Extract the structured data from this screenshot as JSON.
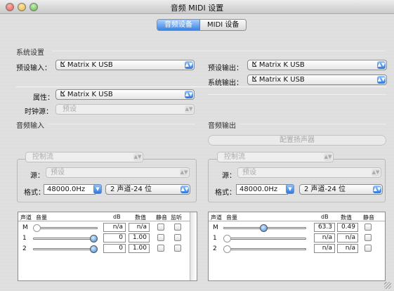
{
  "window": {
    "title": "音频 MIDI 设置"
  },
  "tabs": [
    {
      "label": "音频设备",
      "selected": true
    },
    {
      "label": "MIDI 设备",
      "selected": false
    }
  ],
  "system_settings": {
    "section": "系统设置",
    "default_input_label": "预设输入：",
    "default_input_value": "Matrix K USB",
    "default_output_label": "预设输出：",
    "default_output_value": "Matrix K USB",
    "system_output_label": "系统输出：",
    "system_output_value": "Matrix K USB"
  },
  "device": {
    "properties_label": "属性：",
    "properties_value": "Matrix K USB",
    "clock_label": "时钟源：",
    "clock_value": "预设"
  },
  "audio_input": {
    "section": "音频输入",
    "stream_value": "控制流",
    "source_label": "源：",
    "source_value": "预设",
    "format_label": "格式：",
    "sample_rate": "48000.0Hz",
    "channels": "2 声道-24 位",
    "table": {
      "headers": {
        "channel": "声道",
        "volume": "音量",
        "db": "dB",
        "value": "数值",
        "mute": "静音",
        "monitor": "监听"
      },
      "rows": [
        {
          "channel": "M",
          "level": 0.0,
          "db": "n/a",
          "value": "n/a"
        },
        {
          "channel": "1",
          "level": 1.0,
          "db": "0",
          "value": "1.00"
        },
        {
          "channel": "2",
          "level": 1.0,
          "db": "0",
          "value": "1.00"
        }
      ]
    }
  },
  "audio_output": {
    "section": "音频输出",
    "configure_button": "配置扬声器",
    "stream_value": "控制流",
    "source_label": "源：",
    "source_value": "预设",
    "format_label": "格式：",
    "sample_rate": "48000.0Hz",
    "channels": "2 声道-24 位",
    "table": {
      "headers": {
        "channel": "声道",
        "volume": "音量",
        "db": "dB",
        "value": "数值",
        "mute": "静音"
      },
      "rows": [
        {
          "channel": "M",
          "level": 0.49,
          "db": "63.3",
          "value": "0.49"
        },
        {
          "channel": "1",
          "level": 0.0,
          "db": "n/a",
          "value": "n/a"
        },
        {
          "channel": "2",
          "level": 0.0,
          "db": "n/a",
          "value": "n/a"
        }
      ]
    }
  },
  "colors": {
    "accent": "#3a84e0",
    "close": "#e2574c",
    "minimize": "#e6b43c",
    "zoom": "#5bb543"
  }
}
